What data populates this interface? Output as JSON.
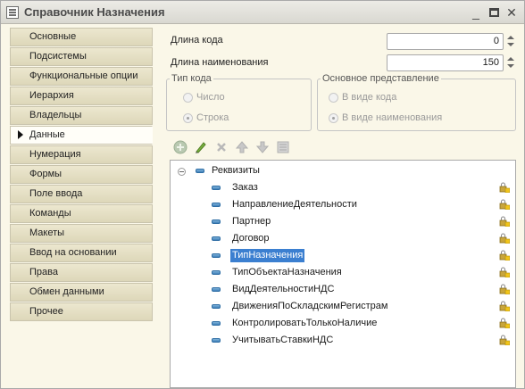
{
  "window": {
    "title": "Справочник Назначения"
  },
  "tabs": [
    {
      "label": "Основные",
      "active": false
    },
    {
      "label": "Подсистемы",
      "active": false
    },
    {
      "label": "Функциональные опции",
      "active": false
    },
    {
      "label": "Иерархия",
      "active": false
    },
    {
      "label": "Владельцы",
      "active": false
    },
    {
      "label": "Данные",
      "active": true
    },
    {
      "label": "Нумерация",
      "active": false
    },
    {
      "label": "Формы",
      "active": false
    },
    {
      "label": "Поле ввода",
      "active": false
    },
    {
      "label": "Команды",
      "active": false
    },
    {
      "label": "Макеты",
      "active": false
    },
    {
      "label": "Ввод на основании",
      "active": false
    },
    {
      "label": "Права",
      "active": false
    },
    {
      "label": "Обмен данными",
      "active": false
    },
    {
      "label": "Прочее",
      "active": false
    }
  ],
  "fields": {
    "code_length_label": "Длина кода",
    "code_length_value": "0",
    "name_length_label": "Длина наименования",
    "name_length_value": "150"
  },
  "code_type": {
    "legend": "Тип кода",
    "options": [
      {
        "label": "Число",
        "selected": false
      },
      {
        "label": "Строка",
        "selected": true
      }
    ]
  },
  "main_presentation": {
    "legend": "Основное представление",
    "options": [
      {
        "label": "В виде кода",
        "selected": false
      },
      {
        "label": "В виде наименования",
        "selected": true
      }
    ]
  },
  "toolbar": {
    "icons": [
      "add-icon",
      "edit-icon",
      "delete-icon",
      "move-up-icon",
      "move-down-icon",
      "sort-icon"
    ]
  },
  "tree": {
    "root_label": "Реквизиты",
    "items": [
      {
        "label": "Заказ",
        "selected": false
      },
      {
        "label": "НаправлениеДеятельности",
        "selected": false
      },
      {
        "label": "Партнер",
        "selected": false
      },
      {
        "label": "Договор",
        "selected": false
      },
      {
        "label": "ТипНазначения",
        "selected": true
      },
      {
        "label": "ТипОбъектаНазначения",
        "selected": false
      },
      {
        "label": "ВидДеятельностиНДС",
        "selected": false
      },
      {
        "label": "ДвиженияПоСкладскимРегистрам",
        "selected": false
      },
      {
        "label": "КонтролироватьТолькоНаличие",
        "selected": false
      },
      {
        "label": "УчитыватьСтавкиНДС",
        "selected": false
      }
    ]
  }
}
